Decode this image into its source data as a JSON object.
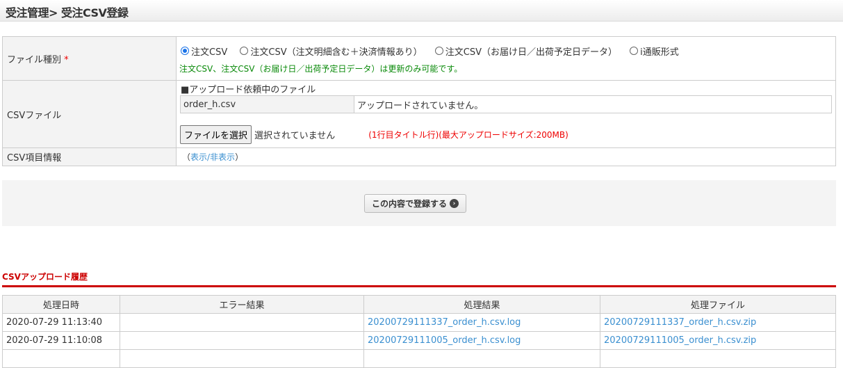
{
  "header": {
    "title": "受注管理> 受注CSV登録"
  },
  "form": {
    "file_type_label": "ファイル種別",
    "required_mark": "*",
    "radios": [
      {
        "label": "注文CSV",
        "checked": true
      },
      {
        "label": "注文CSV（注文明細含む＋決済情報あり）",
        "checked": false
      },
      {
        "label": "注文CSV（お届け日／出荷予定日データ）",
        "checked": false
      },
      {
        "label": "i通販形式",
        "checked": false
      }
    ],
    "note": "注文CSV、注文CSV（お届け日／出荷予定日データ）は更新のみ可能です。",
    "csv_file_label": "CSVファイル",
    "pending_title": "■アップロード依頼中のファイル",
    "pending_file": "order_h.csv",
    "pending_status": "アップロードされていません。",
    "choose_file": "ファイルを選択",
    "no_file": "選択されていません",
    "upload_note": "(1行目タイトル行)(最大アップロードサイズ:200MB)",
    "csv_info_label": "CSV項目情報",
    "toggle_open": "（",
    "toggle_link": "表示/非表示",
    "toggle_close": "）"
  },
  "submit_label": "この内容で登録する",
  "history": {
    "title": "CSVアップロード履歴",
    "columns": [
      "処理日時",
      "エラー結果",
      "処理結果",
      "処理ファイル"
    ],
    "rows": [
      {
        "date": "2020-07-29 11:13:40",
        "error": "",
        "result": "20200729111337_order_h.csv.log",
        "file": "20200729111337_order_h.csv.zip"
      },
      {
        "date": "2020-07-29 11:10:08",
        "error": "",
        "result": "20200729111005_order_h.csv.log",
        "file": "20200729111005_order_h.csv.zip"
      }
    ]
  }
}
